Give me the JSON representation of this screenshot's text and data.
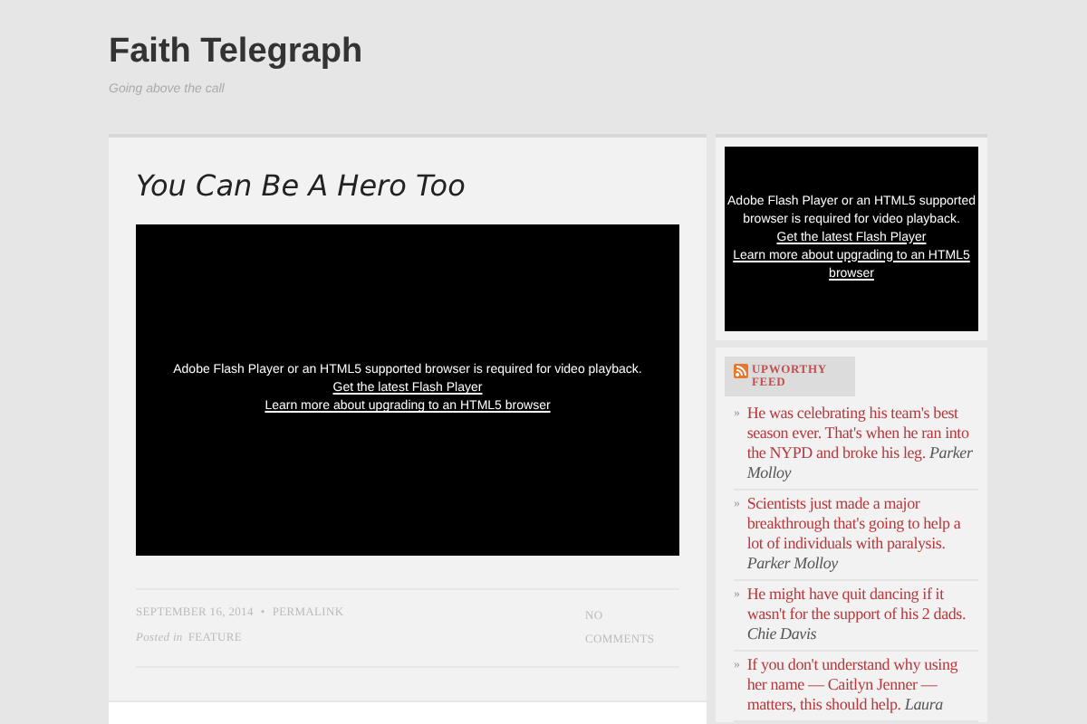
{
  "site": {
    "title": "Faith Telegraph",
    "tagline": "Going above the call"
  },
  "post": {
    "title": "You Can Be A Hero Too",
    "video": {
      "message": "Adobe Flash Player or an HTML5 supported browser is required for video playback.",
      "links": [
        "Get the latest Flash Player",
        "Learn more about upgrading to an HTML5 browser"
      ]
    },
    "date": "SEPTEMBER 16, 2014",
    "separator": "•",
    "permalink": "PERMALINK",
    "posted_in": "Posted in",
    "category": "FEATURE",
    "comments": "NO COMMENTS"
  },
  "sidebar": {
    "video": {
      "message": "Adobe Flash Player or an HTML5 supported browser is required for video playback.",
      "links": [
        "Get the latest Flash Player",
        "Learn more about upgrading to an HTML5 browser"
      ]
    },
    "feed": {
      "title": "UPWORTHY FEED",
      "bullet": "»",
      "items": [
        {
          "text": "He was celebrating his team's best season ever. That's when he ran into the NYPD and broke his leg.",
          "author": "Parker Molloy"
        },
        {
          "text": "Scientists just made a major breakthrough that's going to help a lot of individuals with paralysis.",
          "author": "Parker Molloy"
        },
        {
          "text": "He might have quit dancing if it wasn't for the support of his 2 dads.",
          "author": "Chie Davis"
        },
        {
          "text": "If you don't understand why using her name — Caitlyn Jenner — matters, this should help.",
          "author": "Laura"
        }
      ]
    }
  }
}
